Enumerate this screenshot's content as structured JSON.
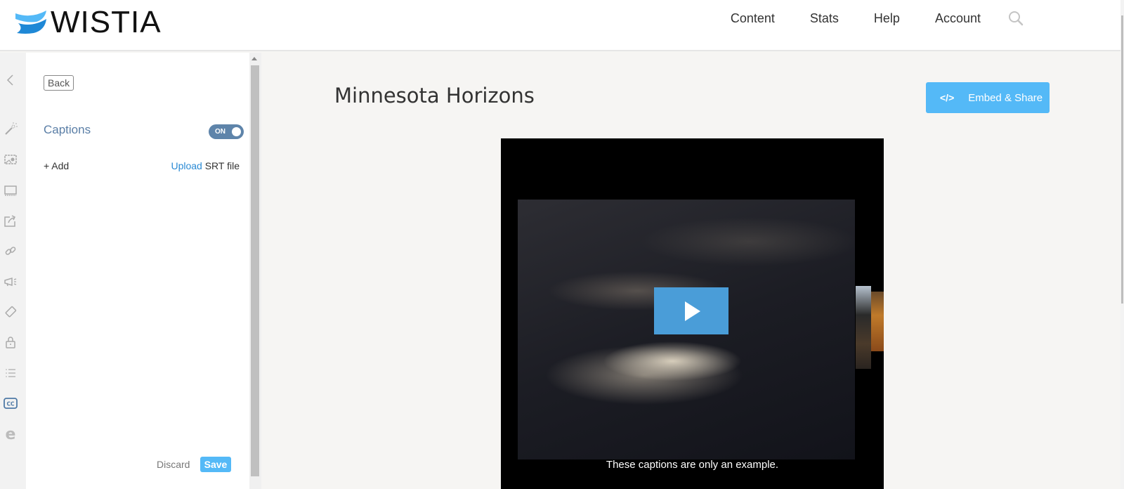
{
  "header": {
    "logo_text": "WISTIA",
    "nav": [
      "Content",
      "Stats",
      "Help",
      "Account"
    ],
    "search_icon": "search-icon"
  },
  "rail": {
    "icons": [
      "chevron-left-icon",
      "magic-wand-icon",
      "thumbnail-icon",
      "player-icon",
      "share-icon",
      "link-icon",
      "megaphone-icon",
      "tag-icon",
      "lock-icon",
      "list-icon",
      "closed-captions-icon",
      "e-icon"
    ],
    "active": "closed-captions-icon"
  },
  "panel": {
    "back_label": "Back",
    "captions_label": "Captions",
    "toggle_label": "ON",
    "toggle_on": true,
    "add_label": "+ Add",
    "upload_link": "Upload",
    "upload_suffix": " SRT file",
    "discard_label": "Discard",
    "save_label": "Save"
  },
  "main": {
    "title": "Minnesota Horizons",
    "embed_label": "Embed & Share",
    "embed_icon": "</>",
    "video": {
      "caption": "These captions are only an example.",
      "play_icon": "play-icon"
    }
  },
  "colors": {
    "accent": "#54b9f7",
    "toggle": "#5e84aa",
    "captions_label": "#5a7ea6",
    "link": "#2a8ad4",
    "play_button": "#4a9dd8"
  }
}
